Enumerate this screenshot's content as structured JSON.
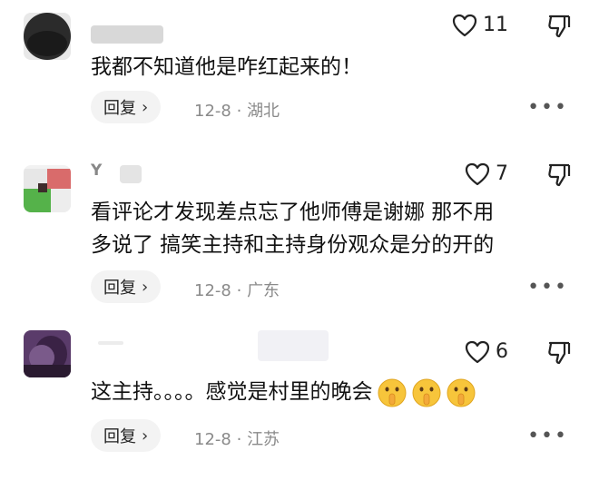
{
  "comments": [
    {
      "username": "",
      "likes": "11",
      "text": "我都不知道他是咋红起来的！",
      "reply_label": "回复",
      "date": "12-8",
      "location": "湖北",
      "separator": "·"
    },
    {
      "username": "Y",
      "likes": "7",
      "text_line1": "看评论才发现差点忘了他师傅是谢娜 那不用",
      "text_line2": "多说了 搞笑主持和主持身份观众是分的开的",
      "reply_label": "回复",
      "date": "12-8",
      "location": "广东",
      "separator": "·"
    },
    {
      "username": "",
      "likes": "6",
      "text": "这主持。。。。感觉是村里的晚会",
      "emojis": [
        "shushing-face-emoji",
        "shushing-face-emoji",
        "shushing-face-emoji"
      ],
      "reply_label": "回复",
      "date": "12-8",
      "location": "江苏",
      "separator": "·"
    }
  ],
  "more_label": "•••",
  "chevron": "›",
  "colors": {
    "text": "#111111",
    "meta": "#8a8a8a",
    "reply_bg": "#f3f3f3",
    "emoji": "#f7c53b"
  }
}
